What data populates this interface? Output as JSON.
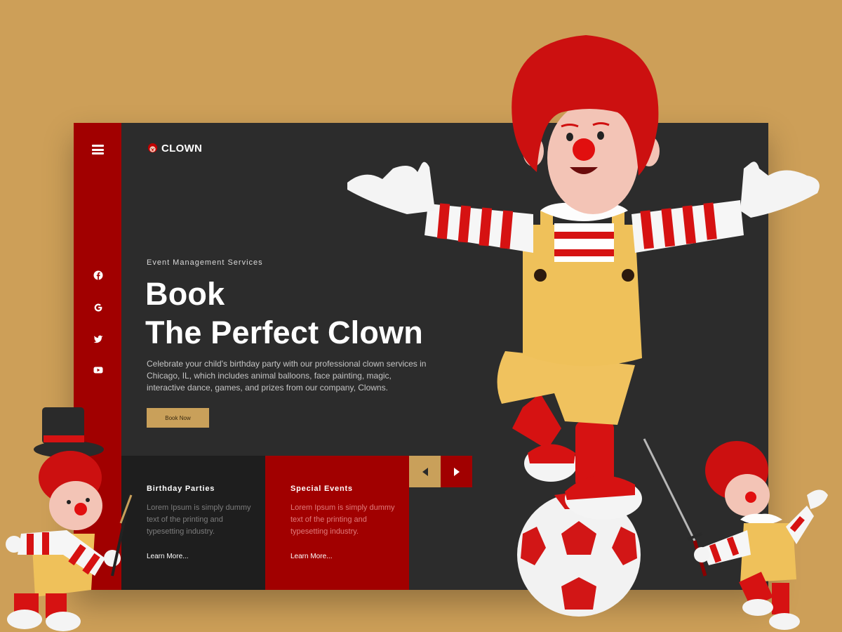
{
  "brand": {
    "name": "CLOWN"
  },
  "sidebar": {
    "social": [
      {
        "icon": "facebook-icon"
      },
      {
        "icon": "google-icon"
      },
      {
        "icon": "twitter-icon"
      },
      {
        "icon": "youtube-icon"
      }
    ]
  },
  "hero": {
    "eyebrow": "Event Management Services",
    "title_line1": "Book",
    "title_line2": "The Perfect Clown",
    "description": "Celebrate your child's birthday party with our professional clown services in Chicago, IL, which includes animal balloons, face painting, magic, interactive dance, games, and prizes from our company, Clowns.",
    "cta_label": "Book Now"
  },
  "services": [
    {
      "title": "Birthday Parties",
      "text": "Lorem Ipsum is simply dummy text of the printing and typesetting industry.",
      "link": "Learn More..."
    },
    {
      "title": "Special Events",
      "text": "Lorem Ipsum is simply dummy text of the printing and typesetting industry.",
      "link": "Learn More..."
    }
  ],
  "colors": {
    "background": "#cd9f58",
    "card": "#2c2c2c",
    "accent_red": "#a10000",
    "accent_gold": "#c9a05a",
    "tile_dark": "#1e1e1e"
  }
}
